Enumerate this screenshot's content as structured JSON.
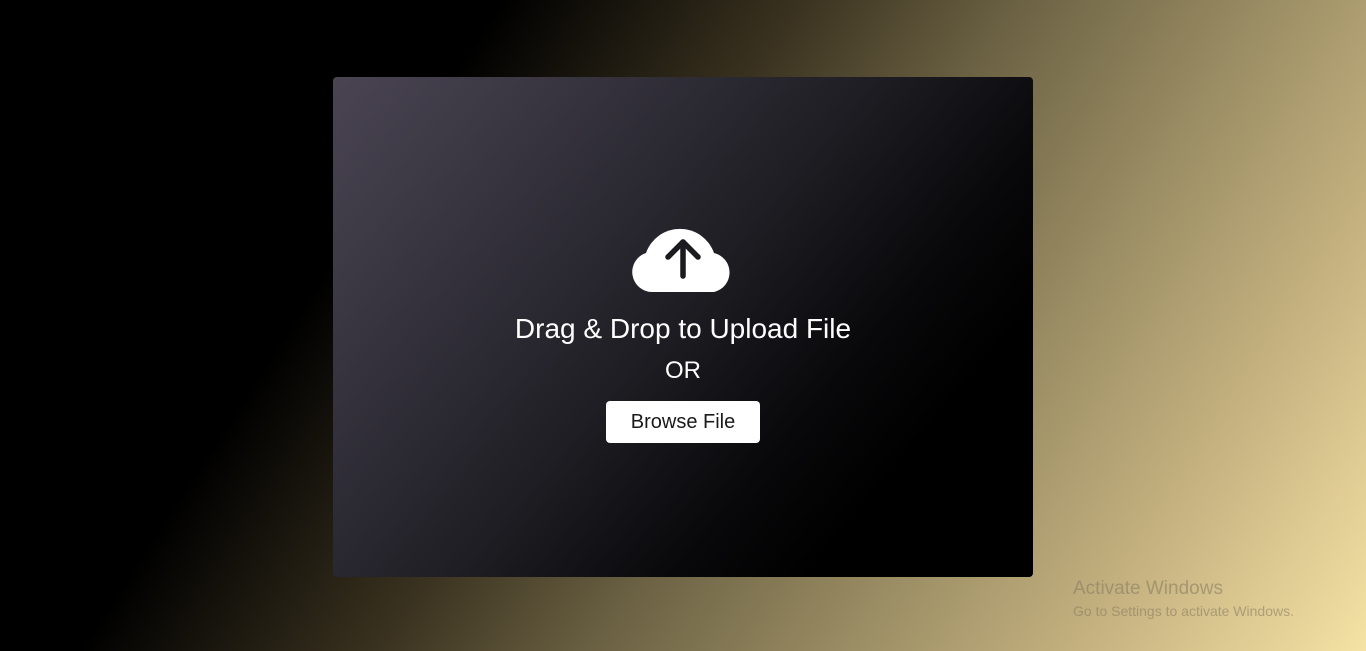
{
  "upload": {
    "icon": "cloud-upload-icon",
    "title": "Drag & Drop to Upload File",
    "or_text": "OR",
    "browse_label": "Browse File"
  },
  "watermark": {
    "title": "Activate Windows",
    "subtitle": "Go to Settings to activate Windows."
  },
  "colors": {
    "panel": "#1f1e24",
    "button_bg": "#ffffff",
    "text": "#ffffff",
    "background_end": "#f5e2a4"
  }
}
